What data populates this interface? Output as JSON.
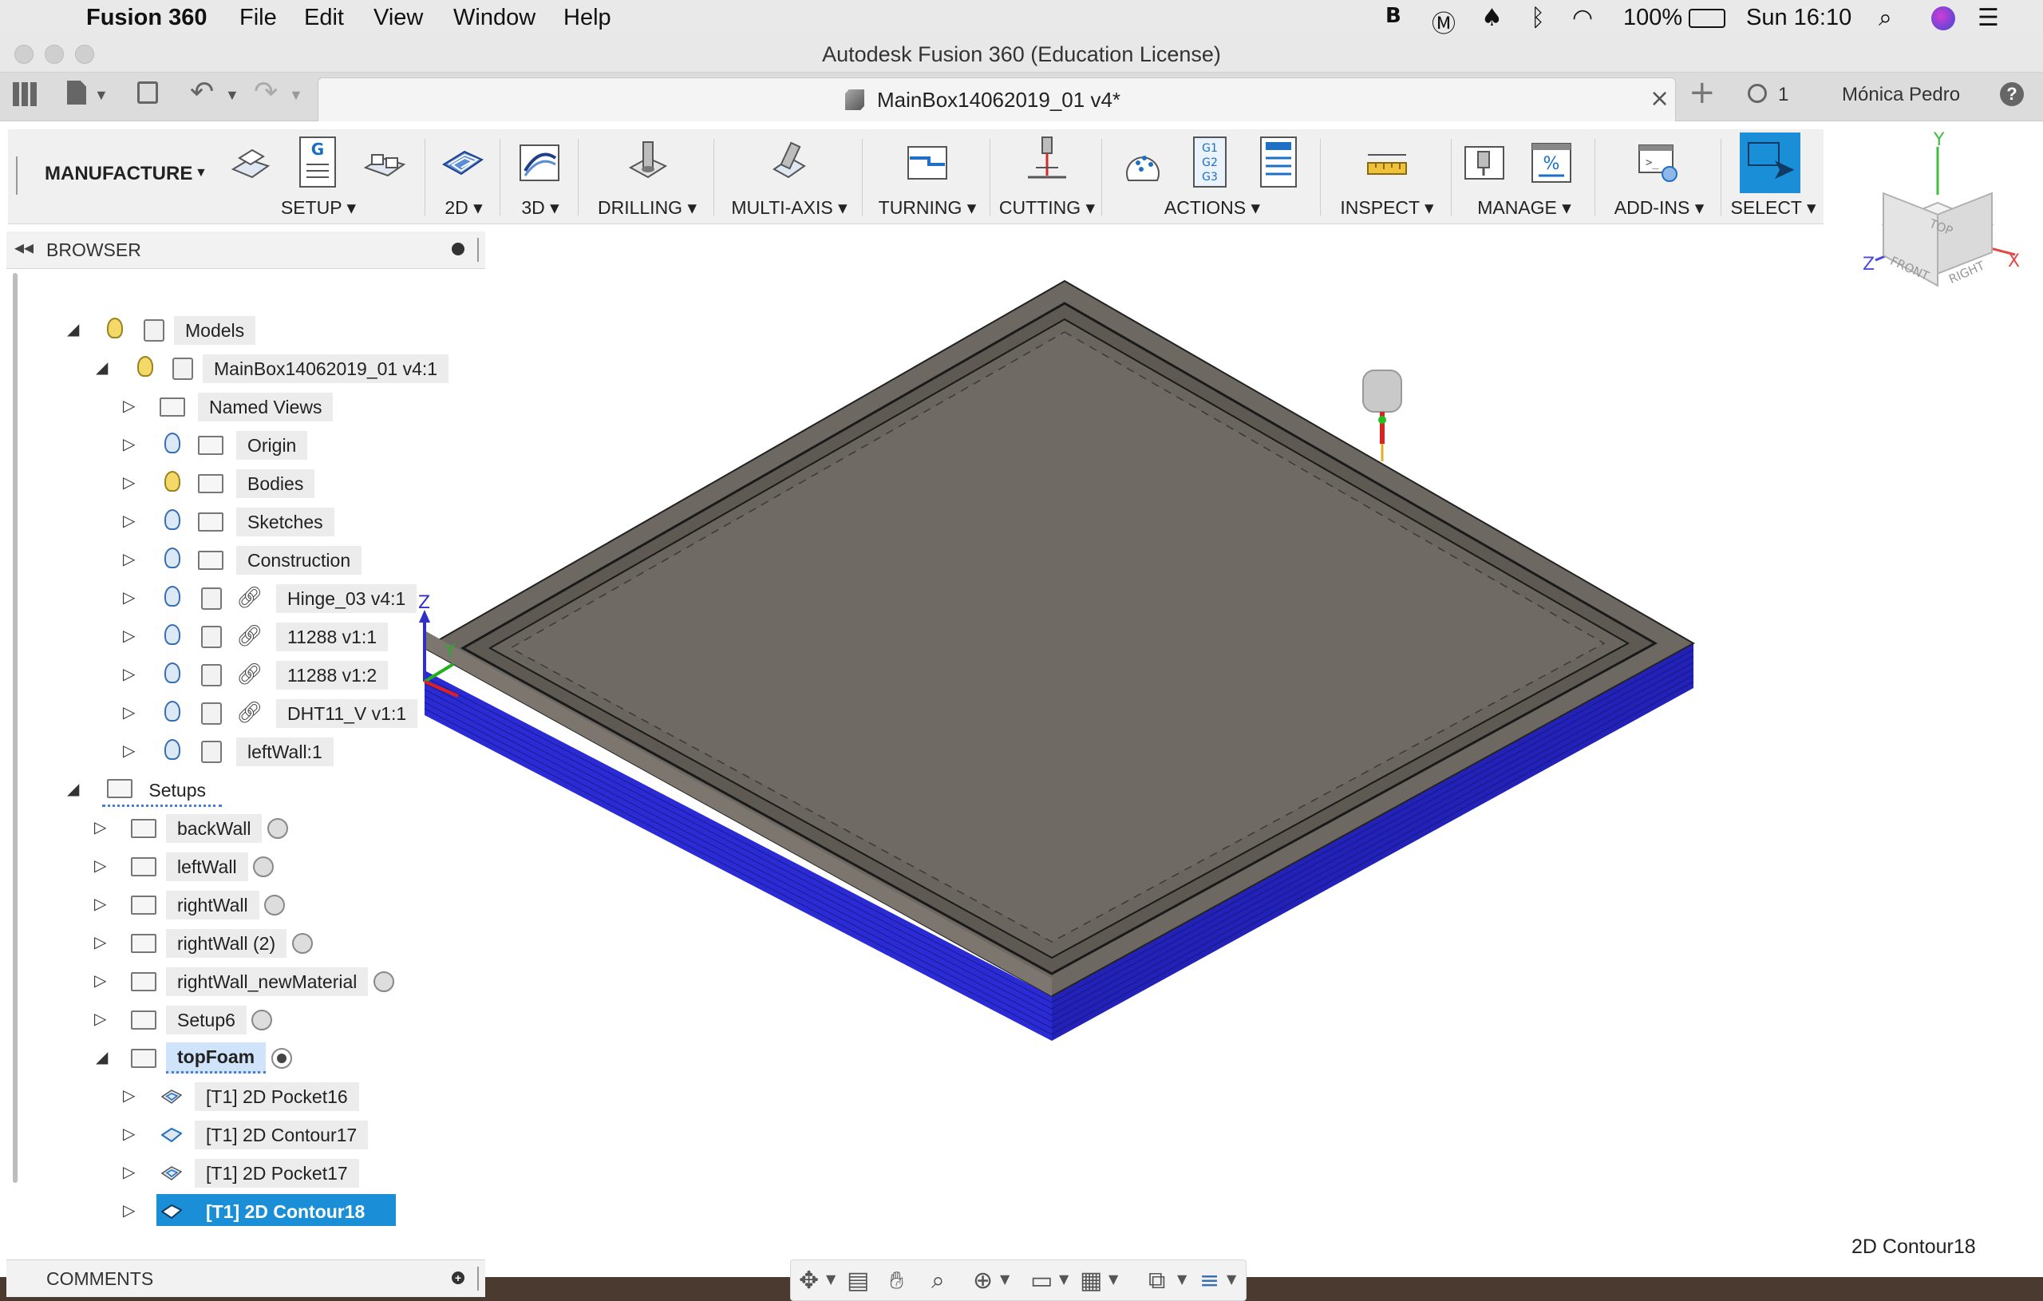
{
  "menubar": {
    "apple": "",
    "app_name": "Fusion 360",
    "menus": [
      "File",
      "Edit",
      "View",
      "Window",
      "Help"
    ],
    "battery": "100%",
    "clock": "Sun 16:10"
  },
  "window": {
    "title": "Autodesk Fusion 360 (Education License)",
    "doc_tab": "MainBox14062019_01 v4*",
    "job_count": "1",
    "user": "Mónica Pedro",
    "help": "?"
  },
  "ribbon": {
    "workspace": "MANUFACTURE",
    "groups": [
      "SETUP",
      "2D",
      "3D",
      "DRILLING",
      "MULTI-AXIS",
      "TURNING",
      "CUTTING",
      "ACTIONS",
      "INSPECT",
      "MANAGE",
      "ADD-INS",
      "SELECT"
    ]
  },
  "browser": {
    "title": "BROWSER",
    "models": "Models",
    "root_component": "MainBox14062019_01 v4:1",
    "model_items": [
      "Named Views",
      "Origin",
      "Bodies",
      "Sketches",
      "Construction",
      "Hinge_03 v4:1",
      "11288 v1:1",
      "11288 v1:2",
      "DHT11_V v1:1",
      "leftWall:1"
    ],
    "setups_label": "Setups",
    "setups": [
      "backWall",
      "leftWall",
      "rightWall",
      "rightWall (2)",
      "rightWall_newMaterial",
      "Setup6",
      "topFoam"
    ],
    "operations": [
      "[T1] 2D Pocket16",
      "[T1] 2D Contour17",
      "[T1] 2D Pocket17",
      "[T1] 2D Contour18"
    ]
  },
  "comments": {
    "title": "COMMENTS"
  },
  "viewcube": {
    "top": "TOP",
    "front": "FRONT",
    "right": "RIGHT",
    "x": "X",
    "y": "Y",
    "z": "Z"
  },
  "triad": {
    "z": "Z",
    "y": "Y"
  },
  "status": {
    "selection": "2D Contour18"
  },
  "colors": {
    "accent": "#1a8fd8",
    "stock_blue": "#2b2bd6",
    "part": "#6b655e"
  }
}
